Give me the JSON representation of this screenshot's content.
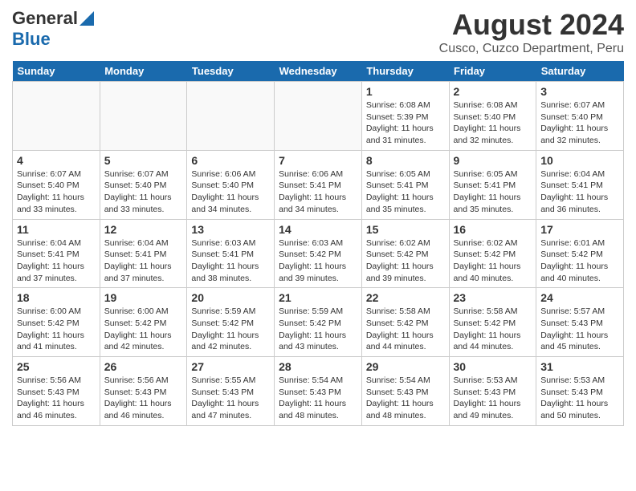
{
  "header": {
    "logo_general": "General",
    "logo_blue": "Blue",
    "title": "August 2024",
    "subtitle": "Cusco, Cuzco Department, Peru"
  },
  "days_of_week": [
    "Sunday",
    "Monday",
    "Tuesday",
    "Wednesday",
    "Thursday",
    "Friday",
    "Saturday"
  ],
  "weeks": [
    [
      {
        "day": "",
        "detail": ""
      },
      {
        "day": "",
        "detail": ""
      },
      {
        "day": "",
        "detail": ""
      },
      {
        "day": "",
        "detail": ""
      },
      {
        "day": "1",
        "detail": "Sunrise: 6:08 AM\nSunset: 5:39 PM\nDaylight: 11 hours and 31 minutes."
      },
      {
        "day": "2",
        "detail": "Sunrise: 6:08 AM\nSunset: 5:40 PM\nDaylight: 11 hours and 32 minutes."
      },
      {
        "day": "3",
        "detail": "Sunrise: 6:07 AM\nSunset: 5:40 PM\nDaylight: 11 hours and 32 minutes."
      }
    ],
    [
      {
        "day": "4",
        "detail": "Sunrise: 6:07 AM\nSunset: 5:40 PM\nDaylight: 11 hours and 33 minutes."
      },
      {
        "day": "5",
        "detail": "Sunrise: 6:07 AM\nSunset: 5:40 PM\nDaylight: 11 hours and 33 minutes."
      },
      {
        "day": "6",
        "detail": "Sunrise: 6:06 AM\nSunset: 5:40 PM\nDaylight: 11 hours and 34 minutes."
      },
      {
        "day": "7",
        "detail": "Sunrise: 6:06 AM\nSunset: 5:41 PM\nDaylight: 11 hours and 34 minutes."
      },
      {
        "day": "8",
        "detail": "Sunrise: 6:05 AM\nSunset: 5:41 PM\nDaylight: 11 hours and 35 minutes."
      },
      {
        "day": "9",
        "detail": "Sunrise: 6:05 AM\nSunset: 5:41 PM\nDaylight: 11 hours and 35 minutes."
      },
      {
        "day": "10",
        "detail": "Sunrise: 6:04 AM\nSunset: 5:41 PM\nDaylight: 11 hours and 36 minutes."
      }
    ],
    [
      {
        "day": "11",
        "detail": "Sunrise: 6:04 AM\nSunset: 5:41 PM\nDaylight: 11 hours and 37 minutes."
      },
      {
        "day": "12",
        "detail": "Sunrise: 6:04 AM\nSunset: 5:41 PM\nDaylight: 11 hours and 37 minutes."
      },
      {
        "day": "13",
        "detail": "Sunrise: 6:03 AM\nSunset: 5:41 PM\nDaylight: 11 hours and 38 minutes."
      },
      {
        "day": "14",
        "detail": "Sunrise: 6:03 AM\nSunset: 5:42 PM\nDaylight: 11 hours and 39 minutes."
      },
      {
        "day": "15",
        "detail": "Sunrise: 6:02 AM\nSunset: 5:42 PM\nDaylight: 11 hours and 39 minutes."
      },
      {
        "day": "16",
        "detail": "Sunrise: 6:02 AM\nSunset: 5:42 PM\nDaylight: 11 hours and 40 minutes."
      },
      {
        "day": "17",
        "detail": "Sunrise: 6:01 AM\nSunset: 5:42 PM\nDaylight: 11 hours and 40 minutes."
      }
    ],
    [
      {
        "day": "18",
        "detail": "Sunrise: 6:00 AM\nSunset: 5:42 PM\nDaylight: 11 hours and 41 minutes."
      },
      {
        "day": "19",
        "detail": "Sunrise: 6:00 AM\nSunset: 5:42 PM\nDaylight: 11 hours and 42 minutes."
      },
      {
        "day": "20",
        "detail": "Sunrise: 5:59 AM\nSunset: 5:42 PM\nDaylight: 11 hours and 42 minutes."
      },
      {
        "day": "21",
        "detail": "Sunrise: 5:59 AM\nSunset: 5:42 PM\nDaylight: 11 hours and 43 minutes."
      },
      {
        "day": "22",
        "detail": "Sunrise: 5:58 AM\nSunset: 5:42 PM\nDaylight: 11 hours and 44 minutes."
      },
      {
        "day": "23",
        "detail": "Sunrise: 5:58 AM\nSunset: 5:42 PM\nDaylight: 11 hours and 44 minutes."
      },
      {
        "day": "24",
        "detail": "Sunrise: 5:57 AM\nSunset: 5:43 PM\nDaylight: 11 hours and 45 minutes."
      }
    ],
    [
      {
        "day": "25",
        "detail": "Sunrise: 5:56 AM\nSunset: 5:43 PM\nDaylight: 11 hours and 46 minutes."
      },
      {
        "day": "26",
        "detail": "Sunrise: 5:56 AM\nSunset: 5:43 PM\nDaylight: 11 hours and 46 minutes."
      },
      {
        "day": "27",
        "detail": "Sunrise: 5:55 AM\nSunset: 5:43 PM\nDaylight: 11 hours and 47 minutes."
      },
      {
        "day": "28",
        "detail": "Sunrise: 5:54 AM\nSunset: 5:43 PM\nDaylight: 11 hours and 48 minutes."
      },
      {
        "day": "29",
        "detail": "Sunrise: 5:54 AM\nSunset: 5:43 PM\nDaylight: 11 hours and 48 minutes."
      },
      {
        "day": "30",
        "detail": "Sunrise: 5:53 AM\nSunset: 5:43 PM\nDaylight: 11 hours and 49 minutes."
      },
      {
        "day": "31",
        "detail": "Sunrise: 5:53 AM\nSunset: 5:43 PM\nDaylight: 11 hours and 50 minutes."
      }
    ]
  ]
}
